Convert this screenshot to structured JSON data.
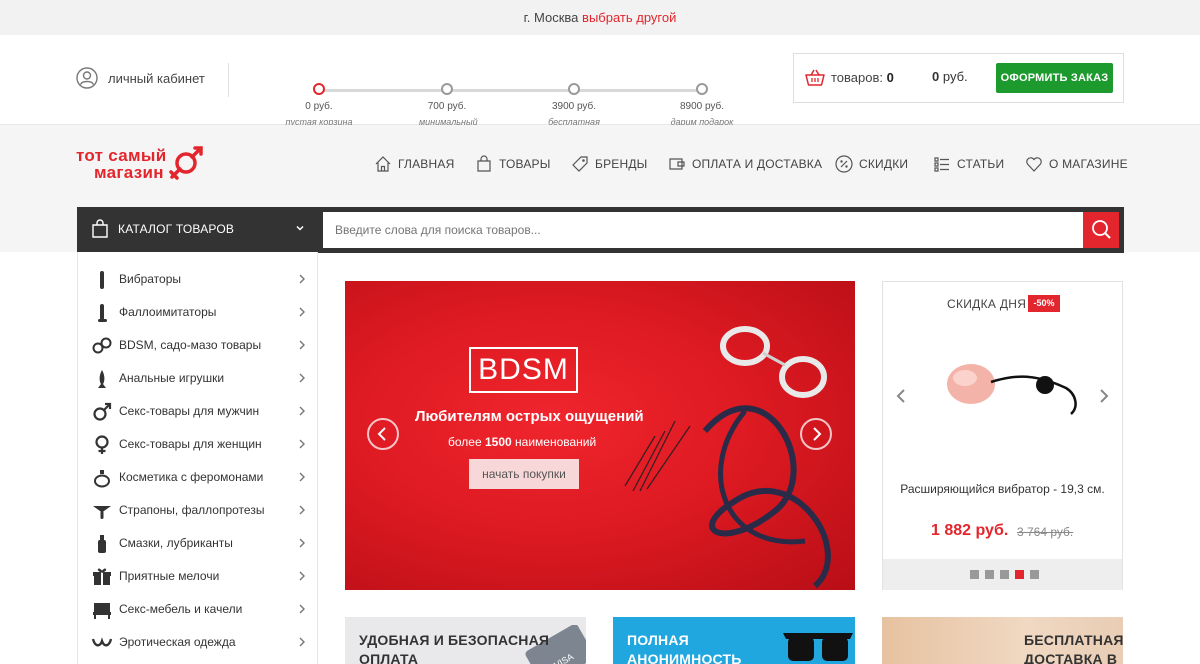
{
  "city_bar": {
    "city": "г. Москва",
    "change_link": "выбрать другой"
  },
  "account": {
    "label": "личный кабинет",
    "icon": "user-icon"
  },
  "progress": {
    "steps": [
      {
        "amount": "0 руб.",
        "desc": "пустая корзина",
        "active": true
      },
      {
        "amount": "700 руб.",
        "desc": "минимальный заказ"
      },
      {
        "amount": "3900 руб.",
        "desc": "бесплатная доставка"
      },
      {
        "amount": "8900 руб.",
        "desc": "дарим подарок"
      }
    ]
  },
  "cart": {
    "items_label": "товаров:",
    "items_count": "0",
    "sum": "0",
    "currency": "руб.",
    "order_button": "ОФОРМИТЬ ЗАКАЗ"
  },
  "logo": {
    "line1": "тот самый",
    "line2": "магазин"
  },
  "nav": {
    "items": [
      {
        "label": "ГЛАВНАЯ",
        "icon": "home-icon"
      },
      {
        "label": "ТОВАРЫ",
        "icon": "bag-icon"
      },
      {
        "label": "БРЕНДЫ",
        "icon": "tag-icon"
      },
      {
        "label": "ОПЛАТА И ДОСТАВКА",
        "icon": "wallet-icon"
      },
      {
        "label": "СКИДКИ",
        "icon": "percent-icon"
      },
      {
        "label": "СТАТЬИ",
        "icon": "list-icon"
      },
      {
        "label": "О МАГАЗИНЕ",
        "icon": "heart-icon"
      }
    ]
  },
  "catalog": {
    "label": "КАТАЛОГ ТОВАРОВ"
  },
  "search": {
    "placeholder": "Введите слова для поиска товаров..."
  },
  "sidebar": {
    "items": [
      {
        "label": "Вибраторы"
      },
      {
        "label": "Фаллоимитаторы"
      },
      {
        "label": "BDSM, садо-мазо товары"
      },
      {
        "label": "Анальные игрушки"
      },
      {
        "label": "Секс-товары для мужчин"
      },
      {
        "label": "Секс-товары для женщин"
      },
      {
        "label": "Косметика с феромонами"
      },
      {
        "label": "Страпоны, фаллопротезы"
      },
      {
        "label": "Смазки, лубриканты"
      },
      {
        "label": "Приятные мелочи"
      },
      {
        "label": "Секс-мебель и качели"
      },
      {
        "label": "Эротическая одежда"
      }
    ]
  },
  "banner": {
    "badge": "BDSM",
    "title": "Любителям острых ощущений",
    "subtitle_pre": "более",
    "subtitle_num": "1500",
    "subtitle_post": "наименований",
    "button": "начать покупки"
  },
  "deal": {
    "title": "СКИДКА ДНЯ",
    "discount": "-50%",
    "product": "Расширяющийся вибратор - 19,3 см.",
    "price": "1 882 руб.",
    "old_price": "3 764 руб.",
    "slides_total": 5,
    "slide_active": 4
  },
  "promos": [
    {
      "line1": "УДОБНАЯ И БЕЗОПАСНАЯ",
      "line2": "ОПЛАТА"
    },
    {
      "line1": "ПОЛНАЯ",
      "line2": "АНОНИМНОСТЬ"
    },
    {
      "line1": "БЕСПЛАТНАЯ",
      "line2": "ДОСТАВКА В"
    }
  ],
  "colors": {
    "accent": "#e3262d",
    "order_green": "#1d9a2e",
    "dark": "#333333"
  }
}
